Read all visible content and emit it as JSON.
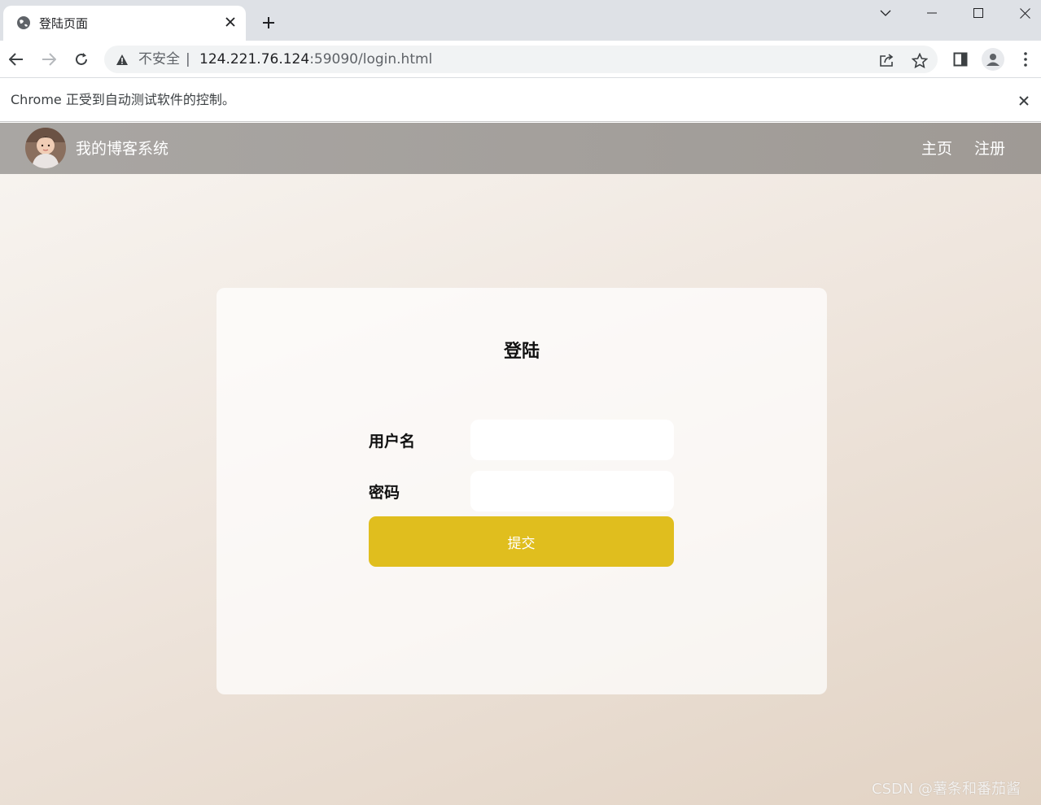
{
  "browser": {
    "tab": {
      "title": "登陆页面"
    },
    "address": {
      "security_label": "不安全",
      "separator": "|",
      "url_host": "124.221.76.124",
      "url_rest": ":59090/login.html"
    },
    "infobar": {
      "message": "Chrome 正受到自动测试软件的控制。"
    }
  },
  "site": {
    "title": "我的博客系统",
    "nav": {
      "home": "主页",
      "register": "注册"
    }
  },
  "login": {
    "heading": "登陆",
    "username_label": "用户名",
    "password_label": "密码",
    "username_value": "",
    "password_value": "",
    "submit_label": "提交"
  },
  "watermark": "CSDN @薯条和番茄酱",
  "colors": {
    "submit_button": "#e0be1e",
    "navbar": "#a39f9b",
    "tabstrip": "#dee1e6"
  }
}
